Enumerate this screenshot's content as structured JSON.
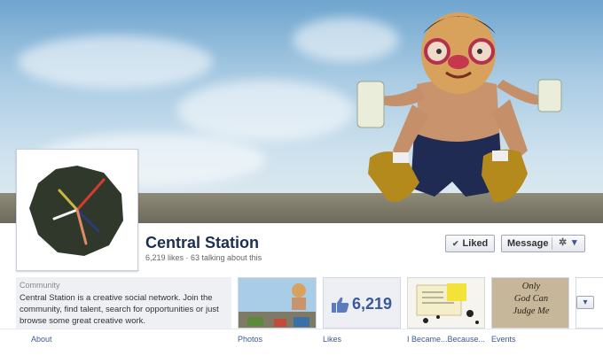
{
  "page": {
    "name": "Central Station",
    "stats": "6,219 likes · 63 talking about this"
  },
  "actions": {
    "liked_label": "Liked",
    "liked_check": "✔",
    "message_label": "Message",
    "gear_glyph": "✲",
    "caret_glyph": "▾"
  },
  "about": {
    "category": "Community",
    "description": "Central Station is a creative social network. Join the community, find talent, search for opportunities or just browse some great creative work.",
    "link_label": "About"
  },
  "apps": {
    "photos_label": "Photos",
    "likes_label": "Likes",
    "likes_count": "6,219",
    "custom_label": "I Became...Because...",
    "events_label": "Events",
    "events_text": [
      "Only",
      "God Can",
      "Judge Me"
    ],
    "more_glyph": "▾"
  },
  "colors": {
    "brand_blue": "#3b5998",
    "title_navy": "#1c2f55"
  }
}
